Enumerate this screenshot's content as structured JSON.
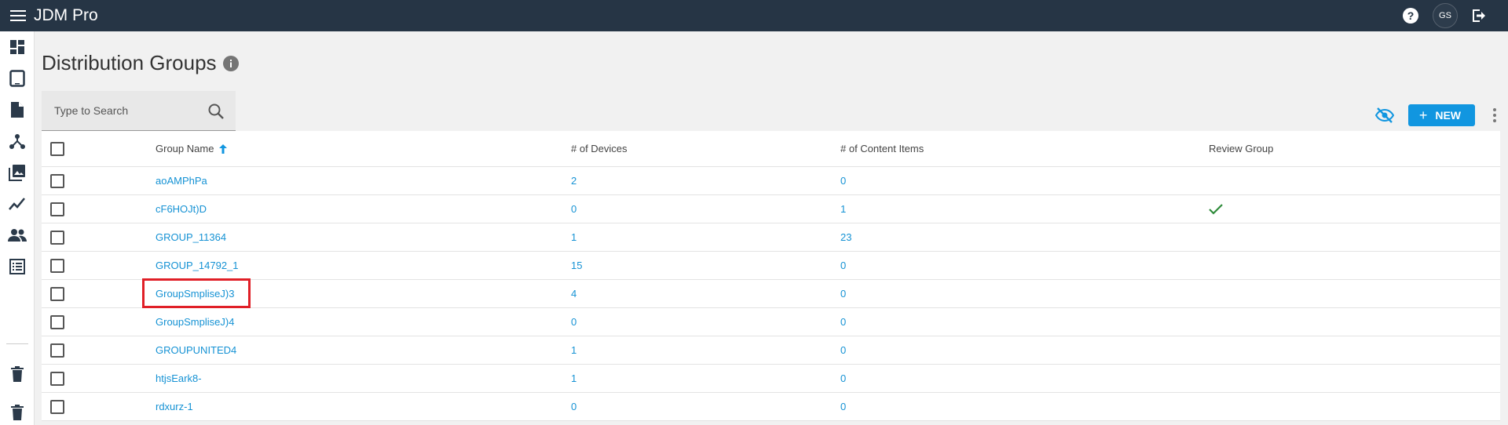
{
  "app": {
    "title": "JDM Pro"
  },
  "user": {
    "initials": "GS"
  },
  "page": {
    "title": "Distribution Groups"
  },
  "search": {
    "placeholder": "Type to Search"
  },
  "toolbar": {
    "new_label": "NEW",
    "new_plus": "+"
  },
  "sidebar": {
    "items": [
      {
        "icon": "dashboard-icon"
      },
      {
        "icon": "tablet-icon"
      },
      {
        "icon": "document-icon"
      },
      {
        "icon": "hierarchy-icon"
      },
      {
        "icon": "image-library-icon"
      },
      {
        "icon": "analytics-icon"
      },
      {
        "icon": "users-icon"
      },
      {
        "icon": "list-icon"
      },
      {
        "icon": "trash-icon"
      },
      {
        "icon": "trash-icon"
      }
    ]
  },
  "table": {
    "columns": {
      "name": "Group Name",
      "devices": "# of Devices",
      "content": "# of Content Items",
      "review": "Review Group"
    },
    "rows": [
      {
        "name": "aoAMPhPa",
        "devices": "2",
        "content": "0",
        "review": false
      },
      {
        "name": "cF6HOJt)D",
        "devices": "0",
        "content": "1",
        "review": true
      },
      {
        "name": "GROUP_11364",
        "devices": "1",
        "content": "23",
        "review": false
      },
      {
        "name": "GROUP_14792_1",
        "devices": "15",
        "content": "0",
        "review": false
      },
      {
        "name": "GroupSmpliseJ)3",
        "devices": "4",
        "content": "0",
        "review": false
      },
      {
        "name": "GroupSmpliseJ)4",
        "devices": "0",
        "content": "0",
        "review": false
      },
      {
        "name": "GROUPUNITED4",
        "devices": "1",
        "content": "0",
        "review": false
      },
      {
        "name": "htjsEark8-",
        "devices": "1",
        "content": "0",
        "review": false
      },
      {
        "name": "rdxurz-1",
        "devices": "0",
        "content": "0",
        "review": false
      }
    ]
  },
  "colors": {
    "topbar": "#263545",
    "accent": "#1196e0",
    "link": "#1592d4",
    "check": "#2e8b3a",
    "highlight": "#e01f27"
  }
}
